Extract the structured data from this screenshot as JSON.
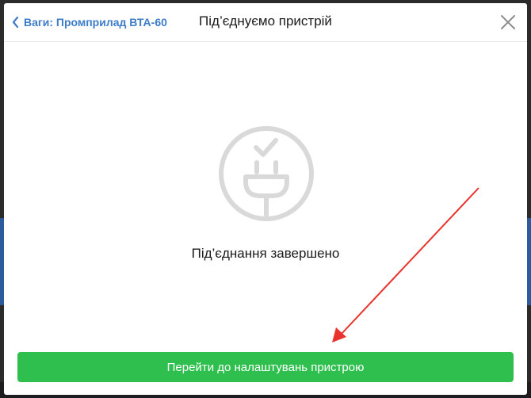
{
  "header": {
    "back_label": "Ваги: Промприлад ВТА-60",
    "title": "Під’єднуємо пристрій",
    "back_icon": "chevron-left-icon",
    "close_icon": "close-icon"
  },
  "main": {
    "status_icon": "plug-connected-icon",
    "status_text": "Під’єднання завершено"
  },
  "footer": {
    "primary_button_label": "Перейти до налаштувань пристрою"
  },
  "colors": {
    "accent_link": "#3d7cc9",
    "primary_button": "#2fbf4f",
    "annotation_arrow": "#e8322b",
    "icon_gray": "#d9d9d9"
  }
}
